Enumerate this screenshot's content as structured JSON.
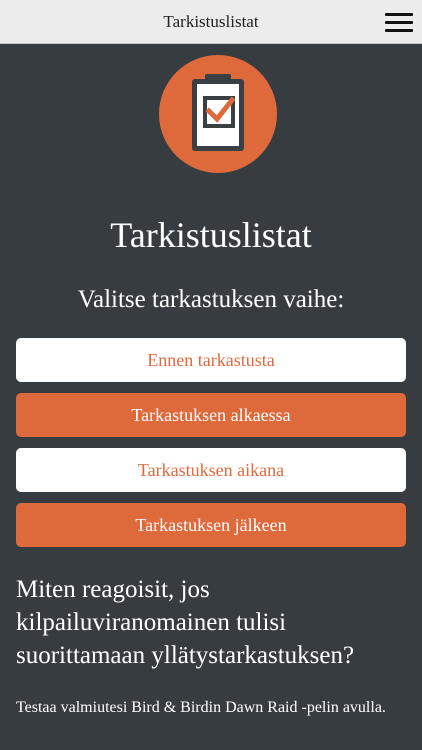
{
  "header": {
    "title": "Tarkistuslistat",
    "menu_icon": "hamburger-menu-icon"
  },
  "logo": {
    "icon": "clipboard-checkmark-icon",
    "circle_color": "#de6a3c"
  },
  "main": {
    "heading": "Tarkistuslistat",
    "subheading": "Valitse tarkastuksen vaihe:",
    "phases": [
      {
        "label": "Ennen tarkastusta",
        "style": "light"
      },
      {
        "label": "Tarkastuksen alkaessa",
        "style": "accent"
      },
      {
        "label": "Tarkastuksen aikana",
        "style": "light"
      },
      {
        "label": "Tarkastuksen jälkeen",
        "style": "accent"
      }
    ],
    "question": "Miten reagoisit, jos kilpailuviranomainen tulisi suorittamaan yllätystarkastuksen?",
    "description": "Testaa valmiutesi Bird & Birdin Dawn Raid -pelin avulla."
  },
  "colors": {
    "background": "#363c40",
    "accent": "#de6a3c",
    "topbar": "#ececec"
  }
}
